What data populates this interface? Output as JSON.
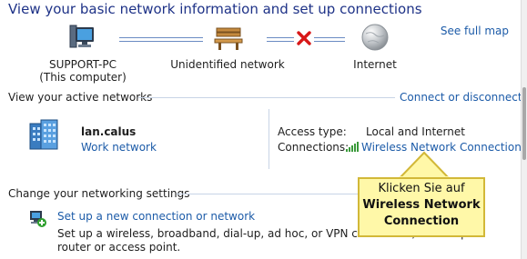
{
  "header": {
    "title": "View your basic network information and set up connections",
    "see_full_map": "See full map"
  },
  "network_map": {
    "computer": {
      "name": "SUPPORT-PC",
      "subtitle": "(This computer)"
    },
    "network": {
      "name": "Unidentified network"
    },
    "internet": {
      "name": "Internet"
    }
  },
  "active_networks": {
    "heading": "View your active networks",
    "connect_link": "Connect or disconnect",
    "network_name": "lan.calus",
    "network_type": "Work network",
    "access_type_label": "Access type:",
    "access_type_value": "Local and Internet",
    "connections_label": "Connections:",
    "connection_name": "Wireless Network Connection"
  },
  "settings": {
    "heading": "Change your networking settings",
    "items": [
      {
        "title": "Set up a new connection or network",
        "description": "Set up a wireless, broadband, dial-up, ad hoc, or VPN connection; or set up a router or access point."
      }
    ]
  },
  "callout": {
    "line1": "Klicken Sie auf",
    "line2": "Wireless Network",
    "line3": "Connection"
  },
  "colors": {
    "title": "#1e3287",
    "link": "#1c5ba8",
    "rule": "#c8d4e6",
    "callout_bg": "#fff8a8",
    "callout_border": "#d2b838"
  }
}
